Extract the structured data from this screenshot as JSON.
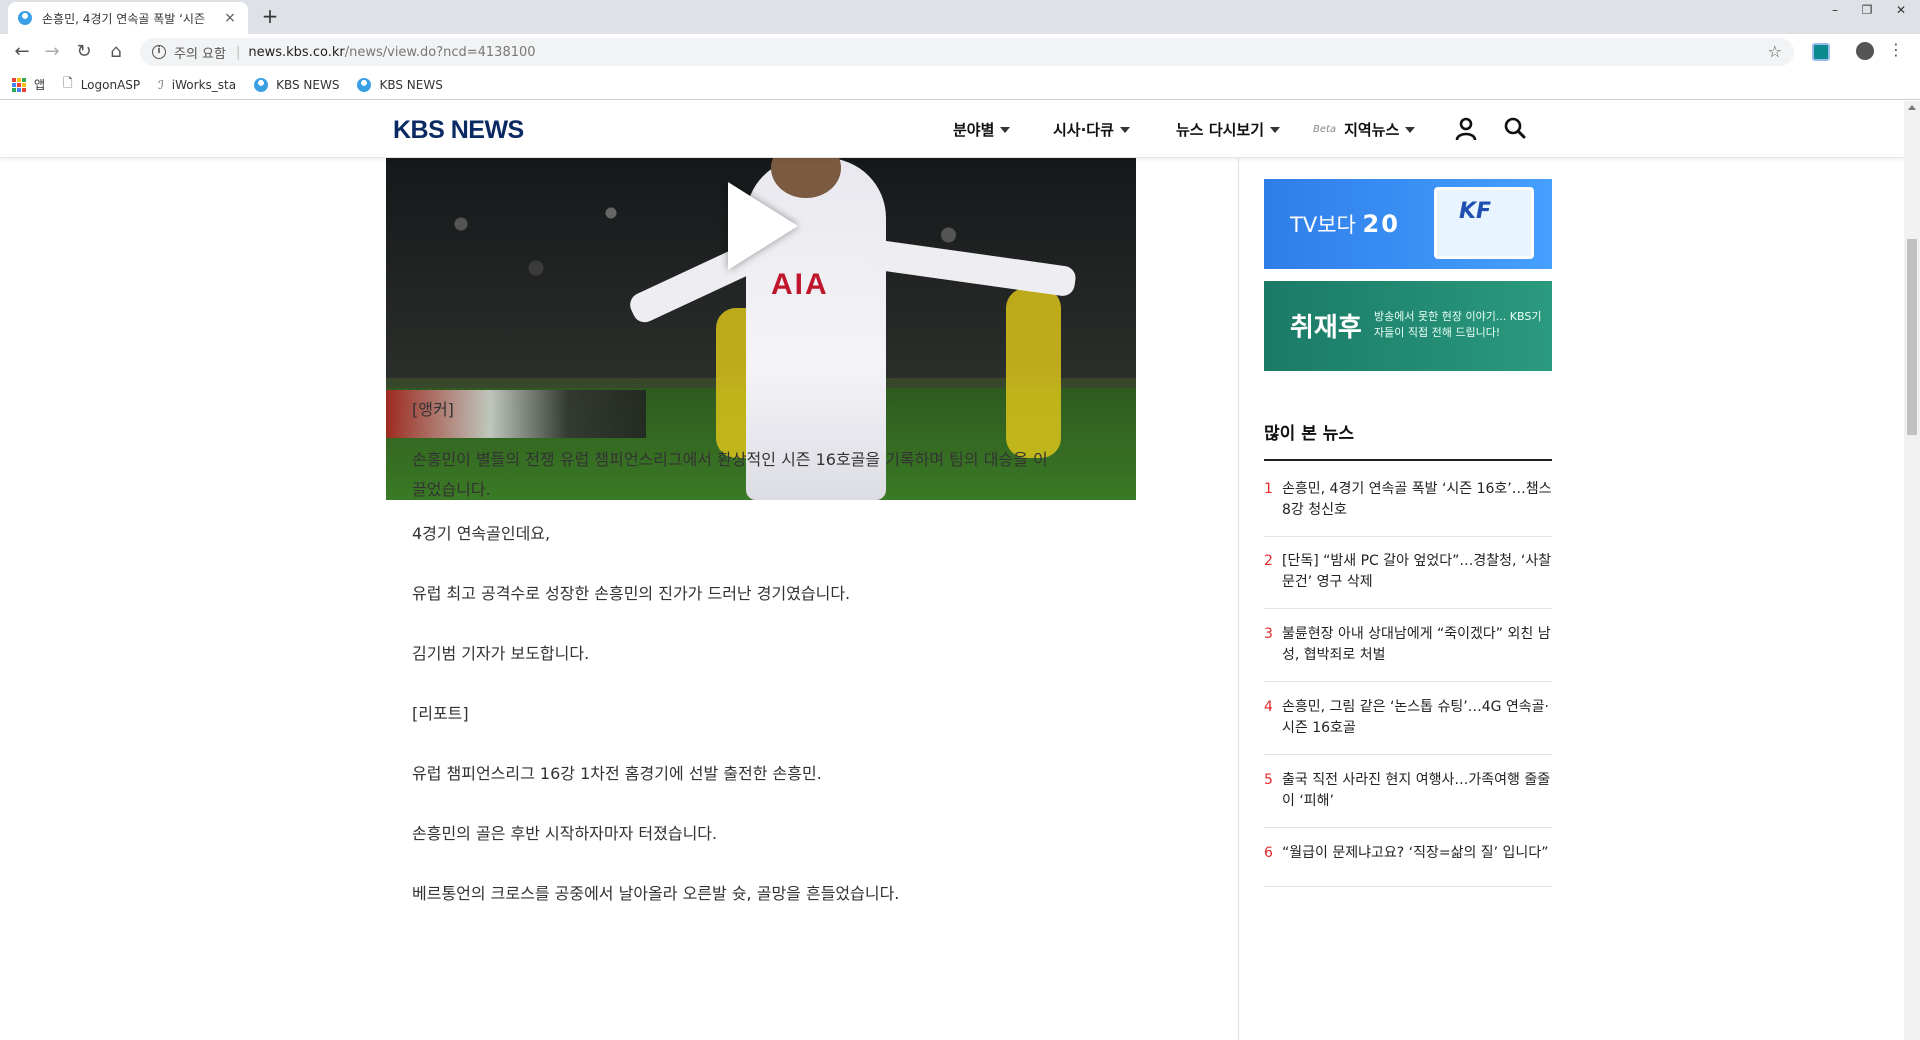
{
  "browser": {
    "tab_title": "손흥민, 4경기 연속골 폭발 ‘시즌",
    "tab_close": "×",
    "new_tab": "+",
    "security_label": "주의 요함",
    "url_host": "news.kbs.co.kr",
    "url_path": "/news/view.do?ncd=4138100",
    "info_glyph": "i",
    "bookmarks": [
      {
        "label": "앱",
        "icon": "apps-icon"
      },
      {
        "label": "LogonASP",
        "icon": "page-icon"
      },
      {
        "label": "iWorks_sta",
        "icon": "iworks-icon"
      },
      {
        "label": "KBS NEWS",
        "icon": "kbs-icon"
      },
      {
        "label": "KBS NEWS",
        "icon": "kbs-icon"
      }
    ],
    "window_controls": {
      "minimize": "–",
      "restore": "❐",
      "close": "✕"
    },
    "nav": {
      "back": "←",
      "forward": "→",
      "reload": "↻",
      "home": "⌂",
      "star": "☆",
      "menu": "⋮"
    }
  },
  "site": {
    "logo": "KBS NEWS",
    "nav": [
      {
        "label": "분야별"
      },
      {
        "label": "시사·다큐"
      },
      {
        "label": "뉴스 다시보기"
      },
      {
        "label": "지역뉴스",
        "badge": "Beta"
      }
    ]
  },
  "video": {
    "jersey_text": "AIA"
  },
  "article": {
    "paragraphs": [
      "[앵커]",
      "손흥민이 별들의 전쟁 유럽 챔피언스리그에서 환상적인 시즌 16호골을 기록하며 팀의 대승을 이끌었습니다.",
      "4경기 연속골인데요,",
      "유럽 최고 공격수로 성장한 손흥민의 진가가 드러난 경기였습니다.",
      "김기범 기자가 보도합니다.",
      "[리포트]",
      "유럽 챔피언스리그 16강 1차전 홈경기에 선발 출전한 손흥민.",
      "손흥민의 골은 후반 시작하자마자 터졌습니다.",
      "베르통언의 크로스를 공중에서 날아올라 오른발 슛, 골망을 흔들었습니다."
    ]
  },
  "sidebar": {
    "banner1": {
      "text": "TV보다 ",
      "strong": "20",
      "logo": "KF"
    },
    "banner2": {
      "title": "취재후",
      "subtitle": "방송에서 못한 현장 이야기... KBS기자들이 직접 전해 드립니다!"
    },
    "popular_title": "많이 본 뉴스",
    "popular": [
      {
        "rank": "1",
        "title": "손흥민, 4경기 연속골 폭발 ‘시즌 16호’…챔스 8강 청신호"
      },
      {
        "rank": "2",
        "title": "[단독] “밤새 PC 갈아 엎었다”…경찰청, ‘사찰 문건’ 영구 삭제"
      },
      {
        "rank": "3",
        "title": "불륜현장 아내 상대남에게 “죽이겠다” 외친 남성, 협박죄로 처벌"
      },
      {
        "rank": "4",
        "title": "손흥민, 그림 같은 ‘논스톱 슈팅’…4G 연속골·시즌 16호골"
      },
      {
        "rank": "5",
        "title": "출국 직전 사라진 현지 여행사…가족여행 줄줄이 ‘피해’"
      },
      {
        "rank": "6",
        "title": "“월급이 문제냐고요? ‘직장=삶의 질’ 입니다”"
      }
    ]
  }
}
